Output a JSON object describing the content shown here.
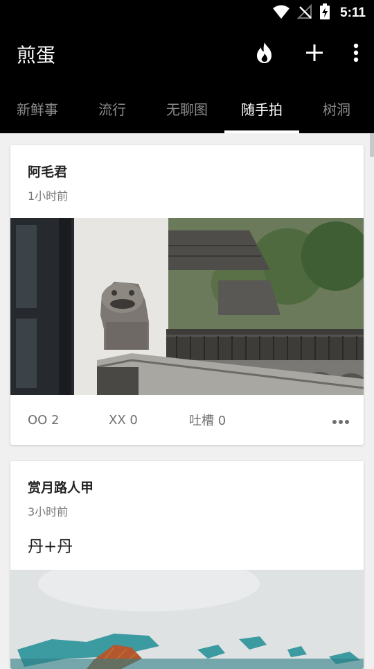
{
  "status_bar": {
    "time": "5:11",
    "icons": [
      "wifi-icon",
      "signal-off-icon",
      "battery-charging-icon"
    ]
  },
  "app_bar": {
    "title": "煎蛋",
    "actions": [
      "flame-icon",
      "plus-icon",
      "more-vertical-icon"
    ]
  },
  "tabs": [
    {
      "label": "新鲜事"
    },
    {
      "label": "流行"
    },
    {
      "label": "无聊图"
    },
    {
      "label": "随手拍",
      "active": true
    },
    {
      "label": "树洞"
    }
  ],
  "posts": [
    {
      "author": "阿毛君",
      "time": "1小时前",
      "oo": "OO 2",
      "xx": "XX 0",
      "comments": "吐槽 0"
    },
    {
      "author": "赏月路人甲",
      "time": "3小时前",
      "text": "丹+丹"
    }
  ],
  "colors": {
    "bar_background": "#000000",
    "tab_inactive": "#8a8a8a",
    "page_background": "#f0f0f0"
  }
}
